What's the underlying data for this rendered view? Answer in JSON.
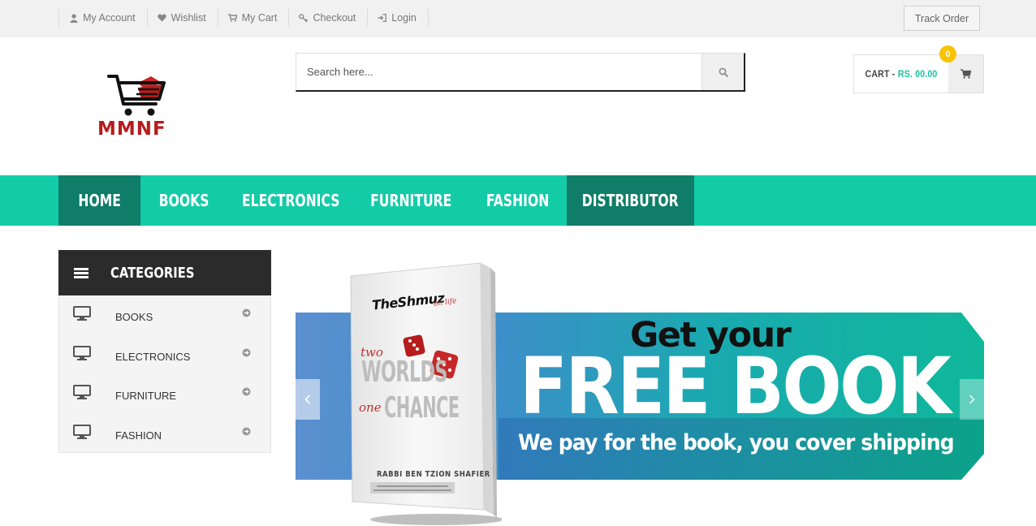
{
  "topbar": {
    "links": [
      {
        "label": "My Account",
        "icon": "user-icon"
      },
      {
        "label": "Wishlist",
        "icon": "heart-icon"
      },
      {
        "label": "My Cart",
        "icon": "cart-icon"
      },
      {
        "label": "Checkout",
        "icon": "key-icon"
      },
      {
        "label": "Login",
        "icon": "sign-in-icon"
      }
    ],
    "track_order": "Track Order"
  },
  "logo": {
    "text": "MMNF",
    "icon": "shopping-cart-logo-icon"
  },
  "search": {
    "placeholder": "Search here...",
    "value": "",
    "icon": "search-icon"
  },
  "cart": {
    "label": "CART -",
    "amount": "RS. 00.00",
    "count": "0",
    "icon": "cart-icon"
  },
  "nav": {
    "items": [
      {
        "label": "HOME",
        "active": true
      },
      {
        "label": "BOOKS"
      },
      {
        "label": "ELECTRONICS"
      },
      {
        "label": "FURNITURE"
      },
      {
        "label": "FASHION"
      },
      {
        "label": "DISTRIBUTOR",
        "highlight": true
      }
    ]
  },
  "categories": {
    "title": "CATEGORIES",
    "items": [
      {
        "label": "BOOKS",
        "icon": "monitor-icon"
      },
      {
        "label": "ELECTRONICS",
        "icon": "monitor-icon"
      },
      {
        "label": "FURNITURE",
        "icon": "monitor-icon"
      },
      {
        "label": "FASHION",
        "icon": "monitor-icon"
      }
    ]
  },
  "banner": {
    "line1": "Get your",
    "line2": "FREE BOOK",
    "line3": "We pay for the book, you cover shipping",
    "book": {
      "brand": "TheShmuz",
      "tagline": "on life",
      "title_a": "two",
      "title_b": "WORLDS",
      "title_c": "one",
      "title_d": "CHANCE",
      "author": "RABBI BEN TZION SHAFIER"
    }
  },
  "colors": {
    "accent": "#14cba8",
    "accent_dark": "#0f7d68",
    "brand_red": "#b71c1c",
    "badge": "#f8c300",
    "category_header": "#2b2b2b"
  }
}
